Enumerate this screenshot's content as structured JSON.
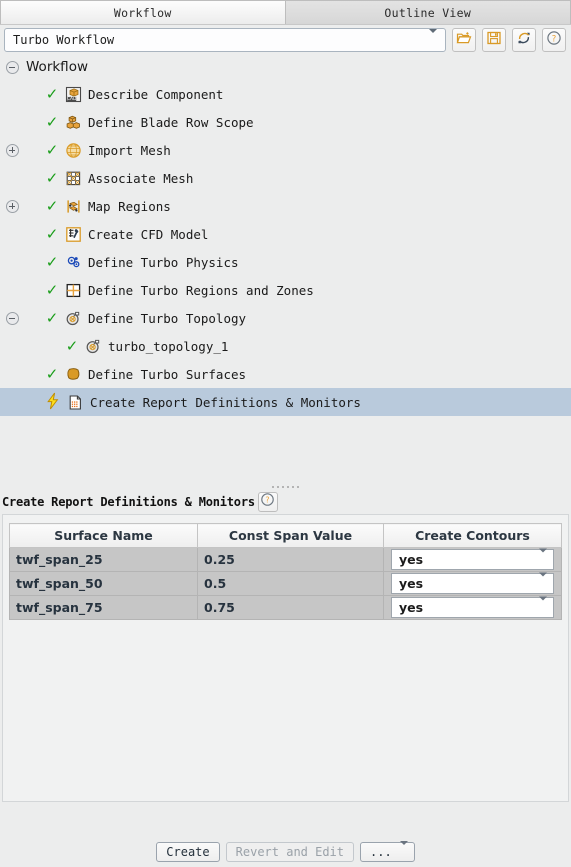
{
  "tabs": [
    {
      "label": "Workflow",
      "active": true
    },
    {
      "label": "Outline View",
      "active": false
    }
  ],
  "toolbar": {
    "workflow_select_value": "Turbo Workflow",
    "buttons": [
      {
        "name": "open-workflow-button",
        "icon": "folder-open-icon"
      },
      {
        "name": "save-workflow-button",
        "icon": "save-icon"
      },
      {
        "name": "reset-workflow-button",
        "icon": "refresh-icon"
      },
      {
        "name": "help-button",
        "icon": "help-circle-icon"
      }
    ]
  },
  "tree": {
    "root_label": "Workflow",
    "items": [
      {
        "label": "Describe Component",
        "icon": "cad-box-icon",
        "state": "complete",
        "toggle": "none",
        "indent": 1
      },
      {
        "label": "Define Blade Row Scope",
        "icon": "boxes-icon",
        "state": "complete",
        "toggle": "none",
        "indent": 1
      },
      {
        "label": "Import Mesh",
        "icon": "mesh-sphere-icon",
        "state": "complete",
        "toggle": "plus",
        "indent": 1
      },
      {
        "label": "Associate Mesh",
        "icon": "grid-mesh-icon",
        "state": "complete",
        "toggle": "none",
        "indent": 1
      },
      {
        "label": "Map Regions",
        "icon": "map-regions-icon",
        "state": "complete",
        "toggle": "plus",
        "indent": 1
      },
      {
        "label": "Create CFD Model",
        "icon": "cfd-model-icon",
        "state": "complete",
        "toggle": "none",
        "indent": 1
      },
      {
        "label": "Define Turbo Physics",
        "icon": "physics-icon",
        "state": "complete",
        "toggle": "none",
        "indent": 1
      },
      {
        "label": "Define Turbo Regions and Zones",
        "icon": "regions-zones-icon",
        "state": "complete",
        "toggle": "none",
        "indent": 1
      },
      {
        "label": "Define Turbo Topology",
        "icon": "topology-icon",
        "state": "complete",
        "toggle": "minus",
        "indent": 1
      },
      {
        "label": "turbo_topology_1",
        "icon": "topology-icon",
        "state": "complete",
        "toggle": "none",
        "indent": 2
      },
      {
        "label": "Define Turbo Surfaces",
        "icon": "surface-icon",
        "state": "complete",
        "toggle": "none",
        "indent": 1
      },
      {
        "label": "Create Report Definitions & Monitors",
        "icon": "report-doc-icon",
        "state": "active",
        "toggle": "none",
        "indent": 1,
        "selected": true
      }
    ]
  },
  "task": {
    "title": "Create Report Definitions & Monitors",
    "help_icon": "help-circle-icon",
    "table": {
      "columns": [
        "Surface Name",
        "Const Span Value",
        "Create Contours"
      ],
      "rows": [
        {
          "surface_name": "twf_span_25",
          "const_span_value": "0.25",
          "create_contours": "yes"
        },
        {
          "surface_name": "twf_span_50",
          "const_span_value": "0.5",
          "create_contours": "yes"
        },
        {
          "surface_name": "twf_span_75",
          "const_span_value": "0.75",
          "create_contours": "yes"
        }
      ]
    }
  },
  "footer": {
    "create_label": "Create",
    "revert_label": "Revert and Edit",
    "more_label": "..."
  },
  "colors": {
    "selection": "#b9cadc",
    "check_green": "#1b9e1b",
    "accent_orange": "#e8a33d",
    "panel_bg": "#eceded",
    "cell_bg": "#c6c6c6"
  }
}
